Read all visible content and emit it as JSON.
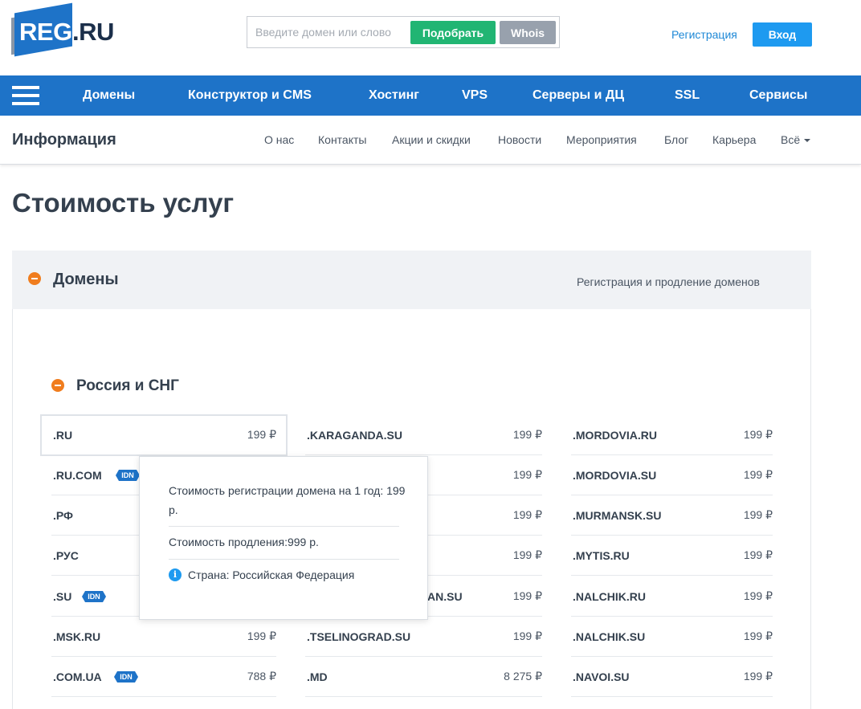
{
  "header": {
    "logo_part1": "REG",
    "logo_part2": ".RU",
    "search_placeholder": "Введите домен или слово",
    "pick_button": "Подобрать",
    "whois_button": "Whois",
    "register_link": "Регистрация",
    "login_button": "Вход"
  },
  "mainnav": {
    "items": [
      "Домены",
      "Конструктор и CMS",
      "Хостинг",
      "VPS",
      "Серверы и ДЦ",
      "SSL",
      "Сервисы"
    ]
  },
  "subnav": {
    "title": "Информация",
    "items": [
      "О нас",
      "Контакты",
      "Акции и скидки",
      "Новости",
      "Мероприятия",
      "Блог",
      "Карьера",
      "Всё"
    ]
  },
  "page_title": "Стоимость услуг",
  "panel": {
    "title": "Домены",
    "subtitle": "Регистрация и продление доменов",
    "group_title": "Россия и СНГ"
  },
  "idn_badge": "IDN",
  "domains": {
    "col1": [
      {
        "name": ".RU",
        "price": "199 ₽"
      },
      {
        "name": ".RU.COM",
        "price": ""
      },
      {
        "name": ".РФ",
        "price": ""
      },
      {
        "name": ".РУС",
        "price": ""
      },
      {
        "name": ".SU",
        "price": ""
      },
      {
        "name": ".MSK.RU",
        "price": "199 ₽"
      },
      {
        "name": ".COM.UA",
        "price": "788 ₽"
      }
    ],
    "col2": [
      {
        "name": ".KARAGANDA.SU",
        "price": "199 ₽"
      },
      {
        "name": "",
        "price": "199 ₽"
      },
      {
        "name": "",
        "price": "199 ₽"
      },
      {
        "name": "",
        "price": "199 ₽"
      },
      {
        "name": "AN.SU",
        "price": "199 ₽"
      },
      {
        "name": ".TSELINOGRAD.SU",
        "price": "199 ₽"
      },
      {
        "name": ".MD",
        "price": "8 275 ₽"
      }
    ],
    "col3": [
      {
        "name": ".MORDOVIA.RU",
        "price": "199 ₽"
      },
      {
        "name": ".MORDOVIA.SU",
        "price": "199 ₽"
      },
      {
        "name": ".MURMANSK.SU",
        "price": "199 ₽"
      },
      {
        "name": ".MYTIS.RU",
        "price": "199 ₽"
      },
      {
        "name": ".NALCHIK.RU",
        "price": "199 ₽"
      },
      {
        "name": ".NALCHIK.SU",
        "price": "199 ₽"
      },
      {
        "name": ".NAVOI.SU",
        "price": "199 ₽"
      }
    ]
  },
  "tooltip": {
    "registration_cost": "Стоимость регистрации домена на 1 год: 199 р.",
    "renewal_cost": "Стоимость продления:999 р.",
    "info_icon": "i",
    "country": "Страна: Российская Федерация"
  }
}
